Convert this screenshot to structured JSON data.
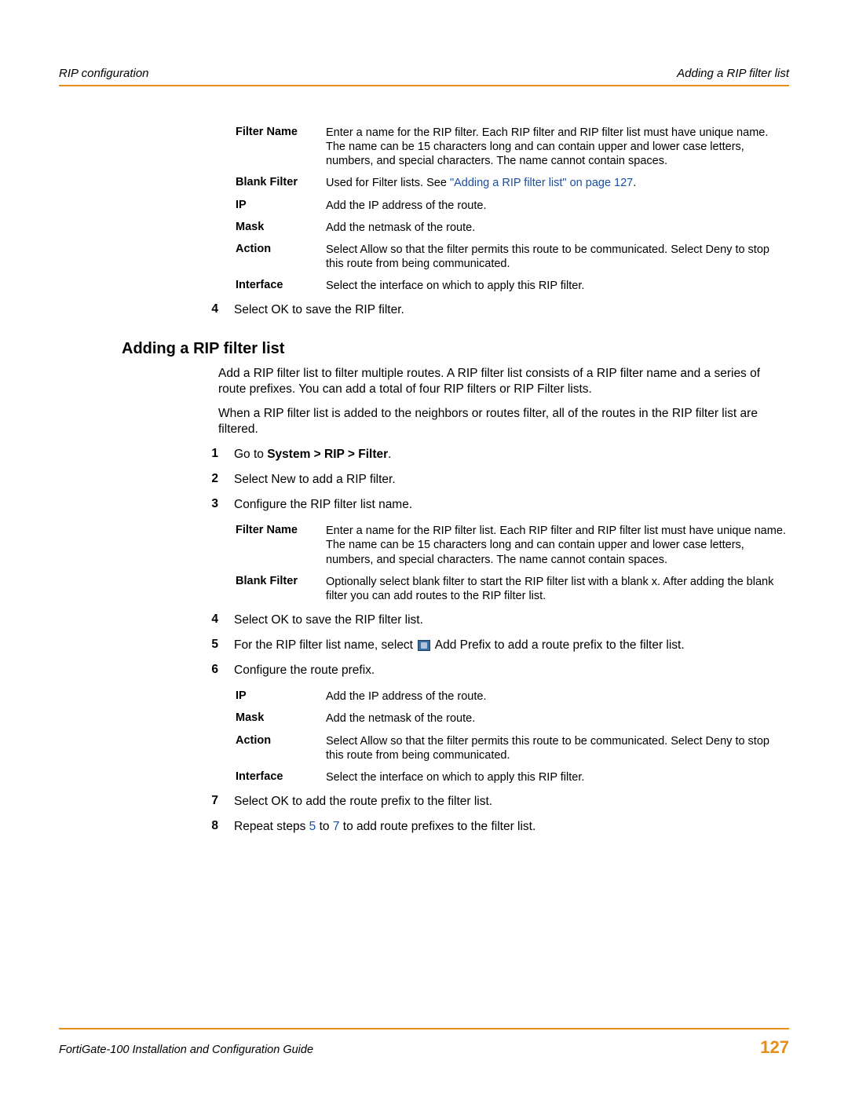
{
  "header": {
    "left": "RIP configuration",
    "right": "Adding a RIP filter list"
  },
  "table1": [
    {
      "term": "Filter Name",
      "desc": "Enter a name for the RIP filter. Each RIP filter and RIP filter list must have unique name. The name can be 15 characters long and can contain upper and lower case letters, numbers, and special characters. The name cannot contain spaces."
    },
    {
      "term": "Blank Filter",
      "desc_prefix": "Used for Filter lists. See ",
      "link": "\"Adding a RIP filter list\" on page 127",
      "desc_suffix": "."
    },
    {
      "term": "IP",
      "desc": "Add the IP address of the route."
    },
    {
      "term": "Mask",
      "desc": "Add the netmask of the route."
    },
    {
      "term": "Action",
      "desc": "Select Allow so that the filter permits this route to be communicated. Select Deny to stop this route from being communicated."
    },
    {
      "term": "Interface",
      "desc": "Select the interface on which to apply this RIP filter."
    }
  ],
  "step4a": {
    "num": "4",
    "text": "Select OK to save the RIP filter."
  },
  "heading": "Adding a RIP filter list",
  "para1": "Add a RIP filter list to filter multiple routes. A RIP filter list consists of a RIP filter name and a series of route prefixes. You can add a total of four RIP filters or RIP Filter lists.",
  "para2": "When a RIP filter list is added to the neighbors or routes filter, all of the routes in the RIP filter list are filtered.",
  "steps_b": [
    {
      "num": "1",
      "prefix": "Go to ",
      "bold": "System > RIP > Filter",
      "suffix": "."
    },
    {
      "num": "2",
      "text": "Select New to add a RIP filter."
    },
    {
      "num": "3",
      "text": "Configure the RIP filter list name."
    }
  ],
  "table2": [
    {
      "term": "Filter Name",
      "desc": "Enter a name for the RIP filter list. Each RIP filter and RIP filter list must have unique name. The name can be 15 characters long and can contain upper and lower case letters, numbers, and special characters. The name cannot contain spaces."
    },
    {
      "term": "Blank Filter",
      "desc": "Optionally select blank filter to start the RIP filter list with a blank x. After adding the blank filter you can add routes to the RIP filter list."
    }
  ],
  "step4b": {
    "num": "4",
    "text": "Select OK to save the RIP filter list."
  },
  "step5b": {
    "num": "5",
    "prefix": "For the RIP filter list name, select ",
    "suffix": " Add Prefix to add a route prefix to the filter list."
  },
  "step6b": {
    "num": "6",
    "text": "Configure the route prefix."
  },
  "table3": [
    {
      "term": "IP",
      "desc": "Add the IP address of the route."
    },
    {
      "term": "Mask",
      "desc": "Add the netmask of the route."
    },
    {
      "term": "Action",
      "desc": "Select Allow so that the filter permits this route to be communicated. Select Deny to stop this route from being communicated."
    },
    {
      "term": "Interface",
      "desc": "Select the interface on which to apply this RIP filter."
    }
  ],
  "step7b": {
    "num": "7",
    "text": "Select OK to add the route prefix to the filter list."
  },
  "step8b": {
    "num": "8",
    "prefix": "Repeat steps ",
    "link1": "5",
    "mid": " to ",
    "link2": "7",
    "suffix": " to add route prefixes to the filter list."
  },
  "footer": {
    "title": "FortiGate-100 Installation and Configuration Guide",
    "page": "127"
  }
}
